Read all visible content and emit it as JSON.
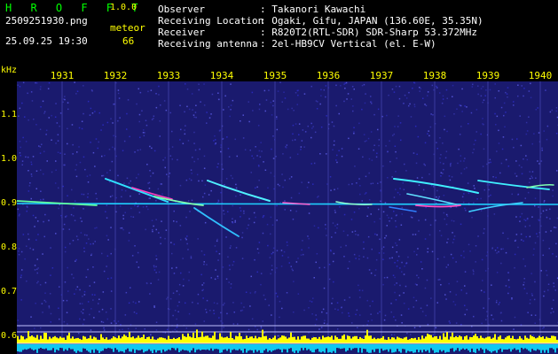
{
  "app": {
    "name": "H R O F F T",
    "version": "1.0.0"
  },
  "file": {
    "name": "2509251930.png",
    "datetime": "25.09.25 19:30"
  },
  "meteor": {
    "label": "meteor",
    "count": "66"
  },
  "station": [
    {
      "key": "Observer",
      "value": ": Takanori Kawachi"
    },
    {
      "key": "Receiving Location",
      "value": ": Ogaki, Gifu, JAPAN (136.60E, 35.35N)"
    },
    {
      "key": "Receiver",
      "value": ": R820T2(RTL-SDR) SDR-Sharp 53.372MHz"
    },
    {
      "key": "Receiving antenna",
      "value": ": 2el-HB9CV Vertical (el. E-W)"
    }
  ],
  "axis": {
    "unit": "kHz",
    "time_ticks": [
      "1931",
      "1932",
      "1933",
      "1934",
      "1935",
      "1936",
      "1937",
      "1938",
      "1939",
      "1940"
    ],
    "freq_ticks": [
      "1.1",
      "1.0",
      "0.9",
      "0.8",
      "0.7",
      "0.6"
    ]
  },
  "colors": {
    "yellow": "#ffff00",
    "green": "#00ff00",
    "bg": "#1a1a6e"
  }
}
